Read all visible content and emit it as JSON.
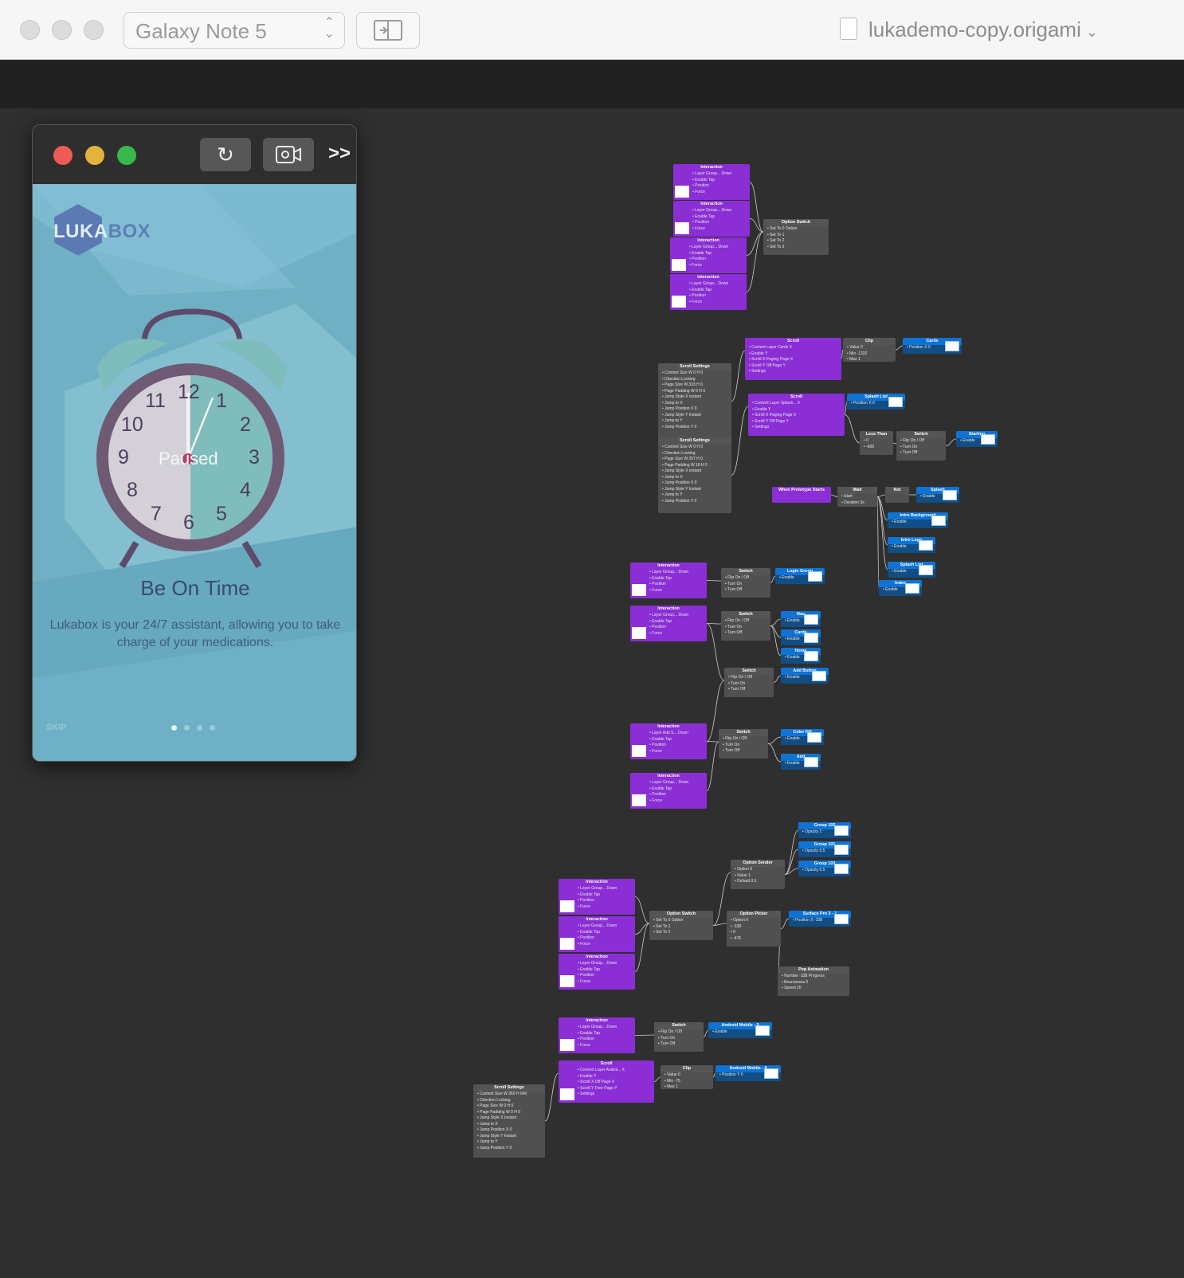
{
  "toolbar": {
    "device_select": "Galaxy Note 5",
    "document_title": "lukademo-copy.origami"
  },
  "viewer": {
    "app": {
      "logo_a": "LUKA",
      "logo_b": "BOX",
      "clock_numbers": [
        "12",
        "1",
        "2",
        "3",
        "4",
        "5",
        "6",
        "7",
        "8",
        "9",
        "10",
        "11"
      ],
      "clock_status": "Paused",
      "headline": "Be On Time",
      "body": "Lukabox is your 24/7 assistant, allowing you to take charge of your medications.",
      "skip": "SKIP",
      "pages": 4,
      "active_page": 1
    }
  },
  "patch_nodes": [
    {
      "title": "Interaction",
      "kind": "purple",
      "ports": [
        "Layer Group...  Down",
        "Enable  Tap",
        "Position",
        "Force"
      ]
    },
    {
      "title": "Interaction",
      "kind": "purple",
      "ports": [
        "Layer Group...  Down",
        "Enable  Tap",
        "Position",
        "Force"
      ]
    },
    {
      "title": "Interaction",
      "kind": "purple",
      "ports": [
        "Layer Group...  Down",
        "Enable  Tap",
        "Position",
        "Force"
      ]
    },
    {
      "title": "Interaction",
      "kind": "purple",
      "ports": [
        "Layer Group...  Down",
        "Enable  Tap",
        "Position",
        "Force"
      ]
    },
    {
      "title": "Option Switch",
      "kind": "gray",
      "ports": [
        "Set To 0   Option",
        "Set To 1",
        "Set To 2",
        "Set To 3"
      ]
    },
    {
      "title": "Scroll",
      "kind": "purple",
      "ports": [
        "Content Layer Cards  X",
        "Enable  Y",
        "Scroll X Paging  Page X",
        "Scroll Y Off  Page Y",
        "Settings"
      ]
    },
    {
      "title": "Clip",
      "kind": "gray",
      "ports": [
        "Value 0",
        "Min -1332",
        "Max 1"
      ]
    },
    {
      "title": "Cards",
      "kind": "blue",
      "ports": [
        "Position X 0"
      ]
    },
    {
      "title": "Scroll Settings",
      "kind": "gray",
      "ports": [
        "Content Size W 0 H 0",
        "Direction Locking",
        "Page Size W 333 H 0",
        "Page Padding W 0 H 0",
        "Jump Style X Instant",
        "Jump to X",
        "Jump Position X 0",
        "Jump Style Y Instant",
        "Jump to Y",
        "Jump Position Y 0"
      ]
    },
    {
      "title": "Scroll",
      "kind": "purple",
      "ports": [
        "Content Layer Splash...  X",
        "Enable  Y",
        "Scroll X Paging  Page X",
        "Scroll Y Off  Page Y",
        "Settings"
      ]
    },
    {
      "title": "Splash List",
      "kind": "blue",
      "ports": [
        "Position X 0"
      ]
    },
    {
      "title": "Scroll Settings",
      "kind": "gray",
      "ports": [
        "Content Size W 0 H 0",
        "Direction Locking",
        "Page Size W 357 H 0",
        "Page Padding W 18 H 0",
        "Jump Style X Instant",
        "Jump to X",
        "Jump Position X 0",
        "Jump Style Y Instant",
        "Jump to Y",
        "Jump Position Y 0"
      ]
    },
    {
      "title": "Less Than",
      "kind": "gray",
      "ports": [
        "0",
        "-800"
      ]
    },
    {
      "title": "Switch",
      "kind": "gray",
      "ports": [
        "Flip  On / Off",
        "Turn On",
        "Turn Off"
      ]
    },
    {
      "title": "Starting",
      "kind": "blue",
      "ports": [
        "Enable"
      ]
    },
    {
      "title": "When Prototype Starts",
      "kind": "purple",
      "ports": [
        ""
      ]
    },
    {
      "title": "Wait",
      "kind": "gray",
      "ports": [
        "Start",
        "Duration 3s"
      ]
    },
    {
      "title": "Not",
      "kind": "gray",
      "ports": [
        ""
      ]
    },
    {
      "title": "Splash",
      "kind": "blue",
      "ports": [
        "Enable"
      ]
    },
    {
      "title": "Intro Background",
      "kind": "blue",
      "ports": [
        "Enable"
      ]
    },
    {
      "title": "Intro Logo",
      "kind": "blue",
      "ports": [
        "Enable"
      ]
    },
    {
      "title": "Splash List",
      "kind": "blue",
      "ports": [
        "Enable"
      ]
    },
    {
      "title": "Index",
      "kind": "blue",
      "ports": [
        "Enable"
      ]
    },
    {
      "title": "Interaction",
      "kind": "purple",
      "ports": [
        "Layer Group...  Down",
        "Enable  Tap",
        "Position",
        "Force"
      ]
    },
    {
      "title": "Switch",
      "kind": "gray",
      "ports": [
        "Flip  On / Off",
        "Turn On",
        "Turn Off"
      ]
    },
    {
      "title": "Login Group",
      "kind": "blue",
      "ports": [
        "Enable"
      ]
    },
    {
      "title": "Interaction",
      "kind": "purple",
      "ports": [
        "Layer Group...  Down",
        "Enable  Tap",
        "Position",
        "Force"
      ]
    },
    {
      "title": "Switch",
      "kind": "gray",
      "ports": [
        "Flip  On / Off",
        "Turn On",
        "Turn Off"
      ]
    },
    {
      "title": "Nav",
      "kind": "blue",
      "ports": [
        "Enable"
      ]
    },
    {
      "title": "Cards",
      "kind": "blue",
      "ports": [
        "Enable"
      ]
    },
    {
      "title": "Home",
      "kind": "blue",
      "ports": [
        "Enable"
      ]
    },
    {
      "title": "Switch",
      "kind": "gray",
      "ports": [
        "Flip  On / Off",
        "Turn On",
        "Turn Off"
      ]
    },
    {
      "title": "Add Button",
      "kind": "blue",
      "ports": [
        "Enable"
      ]
    },
    {
      "title": "Interaction",
      "kind": "purple",
      "ports": [
        "Layer Add S...  Down",
        "Enable  Tap",
        "Position",
        "Force"
      ]
    },
    {
      "title": "Switch",
      "kind": "gray",
      "ports": [
        "Flip  On / Off",
        "Turn On",
        "Turn Off"
      ]
    },
    {
      "title": "Color Fill",
      "kind": "blue",
      "ports": [
        "Enable"
      ]
    },
    {
      "title": "Add",
      "kind": "blue",
      "ports": [
        "Enable"
      ]
    },
    {
      "title": "Interaction",
      "kind": "purple",
      "ports": [
        "Layer Group...  Down",
        "Enable  Tap",
        "Position",
        "Force"
      ]
    },
    {
      "title": "Group 102",
      "kind": "blue",
      "ports": [
        "Opacity 1"
      ]
    },
    {
      "title": "Group 101",
      "kind": "blue",
      "ports": [
        "Opacity 0.5"
      ]
    },
    {
      "title": "Group 103",
      "kind": "blue",
      "ports": [
        "Opacity 0.5"
      ]
    },
    {
      "title": "Option Sender",
      "kind": "gray",
      "ports": [
        "Option 0",
        "Value 1",
        "Default 0.5"
      ]
    },
    {
      "title": "Interaction",
      "kind": "purple",
      "ports": [
        "Layer Group...  Down",
        "Enable  Tap",
        "Position",
        "Force"
      ]
    },
    {
      "title": "Interaction",
      "kind": "purple",
      "ports": [
        "Layer Group...  Down",
        "Enable  Tap",
        "Position",
        "Force"
      ]
    },
    {
      "title": "Interaction",
      "kind": "purple",
      "ports": [
        "Layer Group...  Down",
        "Enable  Tap",
        "Position",
        "Force"
      ]
    },
    {
      "title": "Option Switch",
      "kind": "gray",
      "ports": [
        "Set To 0  Option",
        "Set To 1",
        "Set To 2"
      ]
    },
    {
      "title": "Option Picker",
      "kind": "gray",
      "ports": [
        "Option 0",
        "-338",
        "0",
        "-476"
      ]
    },
    {
      "title": "Surface Pro 3 - 1",
      "kind": "blue",
      "ports": [
        "Position X -338"
      ]
    },
    {
      "title": "Pop Animation",
      "kind": "gray",
      "ports": [
        "Number -338  Progress",
        "Bounciness 0",
        "Speed 20"
      ]
    },
    {
      "title": "Interaction",
      "kind": "purple",
      "ports": [
        "Layer Group...  Down",
        "Enable  Tap",
        "Position",
        "Force"
      ]
    },
    {
      "title": "Switch",
      "kind": "gray",
      "ports": [
        "Flip  On / Off",
        "Turn On",
        "Turn Off"
      ]
    },
    {
      "title": "Android Mobile - 9",
      "kind": "blue",
      "ports": [
        "Enable"
      ]
    },
    {
      "title": "Scroll",
      "kind": "purple",
      "ports": [
        "Content Layer Androi...  X",
        "Enable  Y",
        "Scroll X Off  Page X",
        "Scroll Y Free  Page Y",
        "Settings"
      ]
    },
    {
      "title": "Clip",
      "kind": "gray",
      "ports": [
        "Value 0",
        "Min -75",
        "Max 1"
      ]
    },
    {
      "title": "Android Mobile - 9",
      "kind": "blue",
      "ports": [
        "Position Y 0"
      ]
    },
    {
      "title": "Scroll Settings",
      "kind": "gray",
      "ports": [
        "Content Size W 360 H 640",
        "Direction Locking",
        "Page Size W 0 H 0",
        "Page Padding W 0 H 0",
        "Jump Style X Instant",
        "Jump to X",
        "Jump Position X 0",
        "Jump Style Y Instant",
        "Jump to Y",
        "Jump Position Y 0"
      ]
    }
  ]
}
